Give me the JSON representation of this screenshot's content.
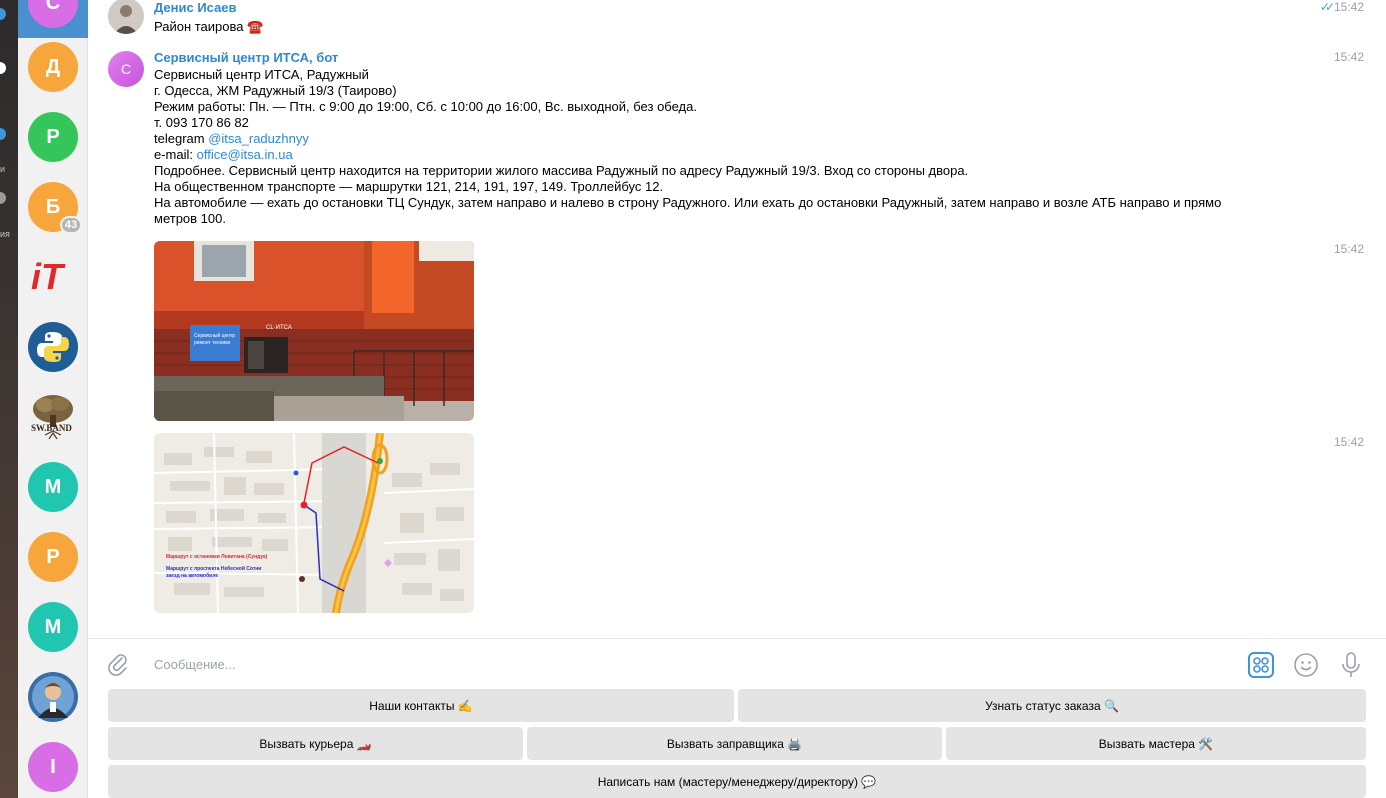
{
  "folder_strip": {
    "labels": [
      "и",
      "ия"
    ]
  },
  "chat_list": [
    {
      "letter": "С",
      "color": "#d76ee6",
      "active": true
    },
    {
      "letter": "Д",
      "color": "#f6a63b"
    },
    {
      "letter": "Р",
      "color": "#35c65b"
    },
    {
      "letter": "Б",
      "color": "#f6a63b",
      "badge": "43"
    },
    {
      "logo": "iT",
      "color": "#e02a2a"
    },
    {
      "logo": "python",
      "color": "#1f5d96"
    },
    {
      "logo": "SW.BAND",
      "color": "#6b5337"
    },
    {
      "letter": "М",
      "color": "#20c6b0"
    },
    {
      "letter": "Р",
      "color": "#f6a63b"
    },
    {
      "letter": "М",
      "color": "#20c6b0"
    },
    {
      "logo": "person",
      "color": "#3a6ca6"
    },
    {
      "letter": "I",
      "color": "#d76ee6"
    }
  ],
  "messages": {
    "first": {
      "author": "Денис Исаев",
      "text": "Район таирова ☎️",
      "time": "15:42"
    },
    "second": {
      "author": "Сервисный центр ИТСА, бот",
      "avatar_letter": "С",
      "time": "15:42",
      "lines": {
        "l1": "Сервисный центр ИТСА, Радужный",
        "l2": "г. Одесса, ЖМ Радужный 19/3 (Таирово)",
        "l3": "Режим работы: Пн. — Птн. с 9:00 до 19:00, Сб. с 10:00 до 16:00, Вс. выходной, без обеда.",
        "l4": "т. 093 170 86 82",
        "l5_prefix": "telegram ",
        "l5_link": "@itsa_raduzhnyy",
        "l6_prefix": "e-mail: ",
        "l6_link": "office@itsa.in.ua",
        "l7": "Подробнее. Сервисный центр находится на территории жилого массива Радужный по адресу Радужный 19/3. Вход со стороны двора.",
        "l8": "На общественном транспорте — маршрутки 121, 214, 191, 197, 149. Троллейбус 12.",
        "l9": "На автомобиле — ехать до остановки ТЦ Сундук, затем направо и налево в строну Радужного. Или ехать до остановки Радужный, затем направо и возле АТБ направо и прямо",
        "l10": "метров 100."
      }
    },
    "photo1": {
      "time": "15:42",
      "sign": "CL·ИТСА",
      "banner_l1": "Сервисный центр",
      "banner_l2": "ремонт техники"
    },
    "photo2": {
      "time": "15:42",
      "legend_red": "Маршрут с остановки Левитана (Сундук)",
      "legend_blue_l1": "Маршрут с проспекта Небесной Сотни",
      "legend_blue_l2": "заезд на автомобиле"
    }
  },
  "composer": {
    "placeholder": "Сообщение..."
  },
  "keyboard": {
    "row1": [
      "Наши контакты ✍️",
      "Узнать статус заказа 🔍"
    ],
    "row2": [
      "Вызвать курьера 🏎️",
      "Вызвать заправщика 🖨️",
      "Вызвать мастера 🛠️"
    ],
    "row3": [
      "Написать нам (мастеру/менеджеру/директору) 💬"
    ]
  }
}
